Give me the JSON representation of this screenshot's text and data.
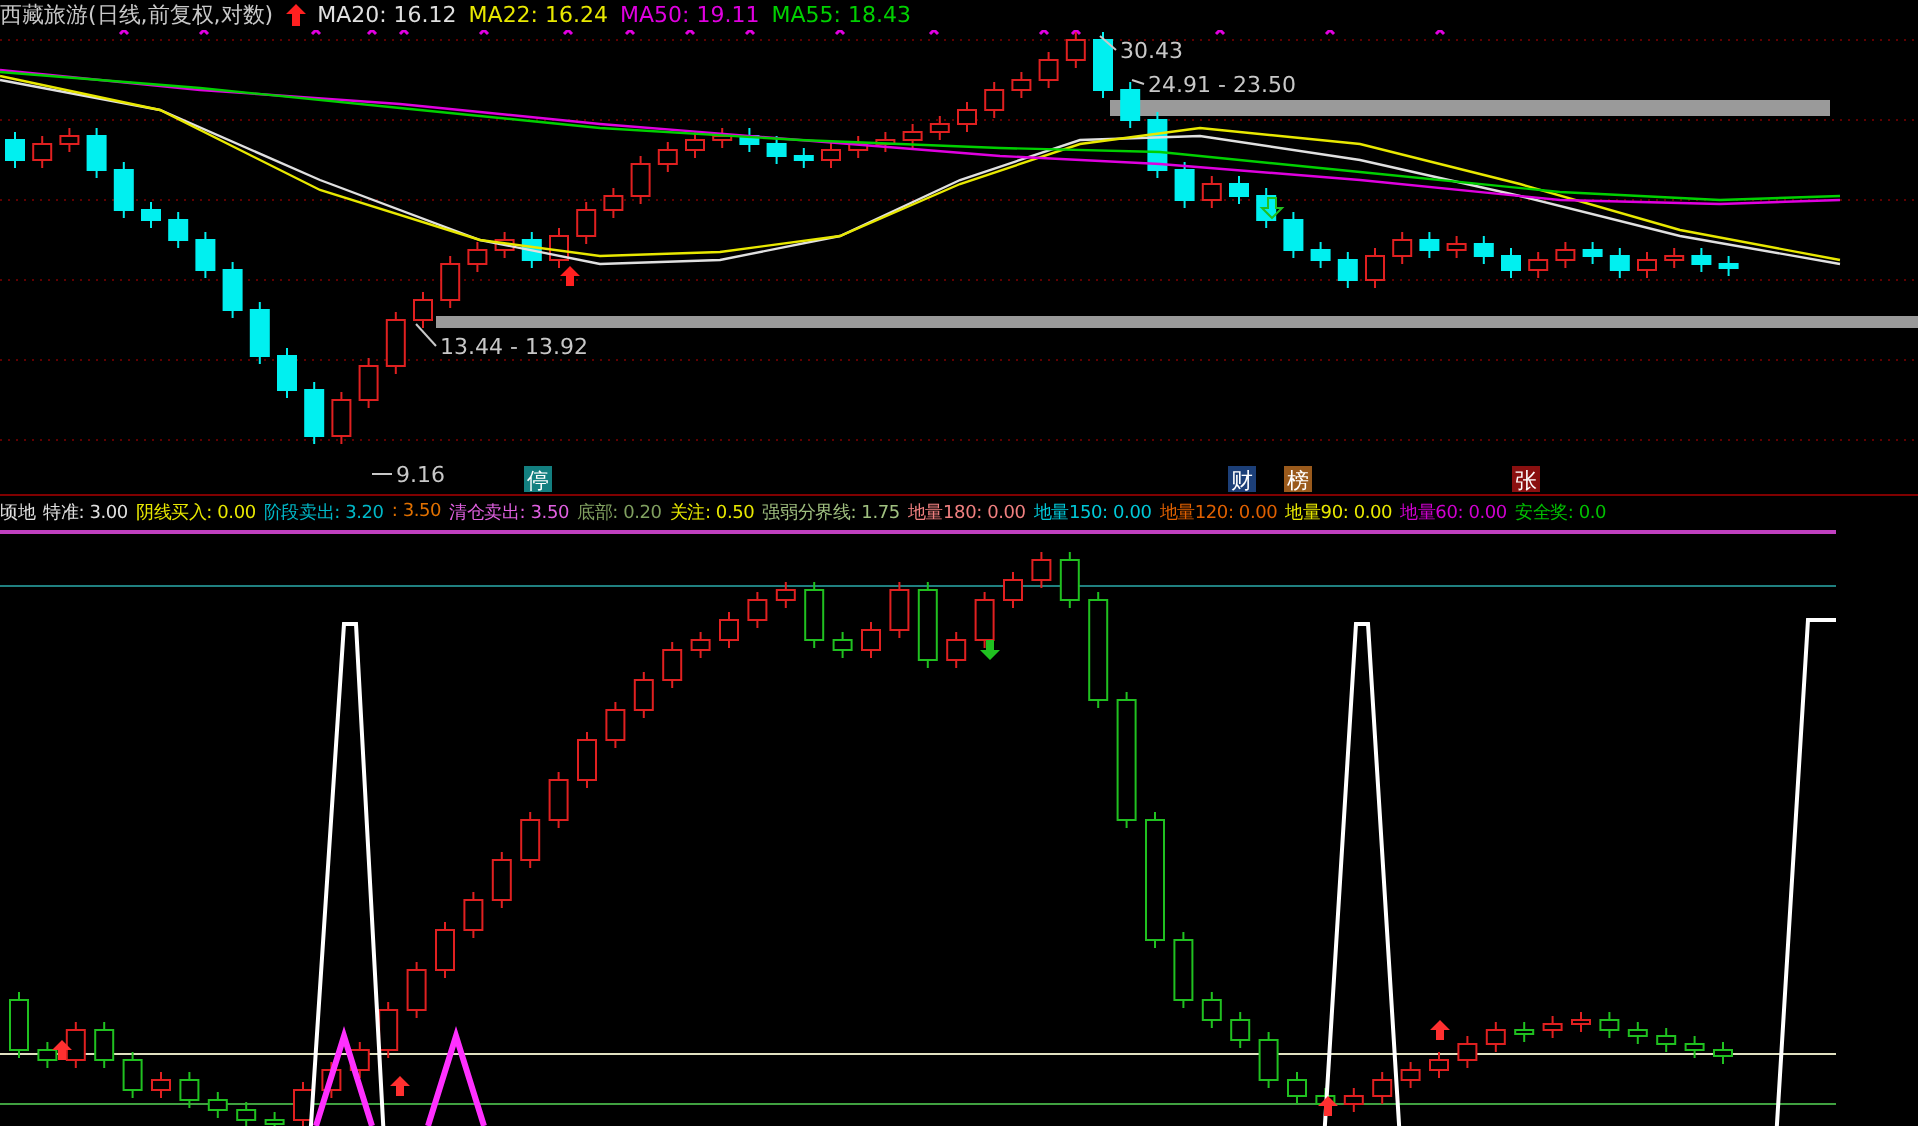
{
  "header": {
    "title": "西藏旅游(日线,前复权,对数)",
    "legend": [
      {
        "label": "MA20: 16.12",
        "color": "#e0e0e0"
      },
      {
        "label": "MA22: 16.24",
        "color": "#e8e800"
      },
      {
        "label": "MA50: 19.11",
        "color": "#e000e0"
      },
      {
        "label": "MA55: 18.43",
        "color": "#00d000"
      }
    ]
  },
  "price_chart": {
    "annotations": [
      {
        "text": "30.43"
      },
      {
        "text": "24.91 - 23.50"
      },
      {
        "text": "13.44 - 13.92"
      },
      {
        "text": "9.16"
      }
    ],
    "badges": [
      {
        "text": "停",
        "color": "#137f80"
      },
      {
        "text": "财",
        "color": "#1c3f78"
      },
      {
        "text": "榜",
        "color": "#9a5a1c"
      },
      {
        "text": "张",
        "color": "#8a1010"
      }
    ]
  },
  "indicator": {
    "legend": [
      {
        "label": "顷地",
        "color": "#e0e0e0"
      },
      {
        "label": "特准: 3.00",
        "color": "#e0e0e0"
      },
      {
        "label": "阴线买入: 0.00",
        "color": "#e8e800"
      },
      {
        "label": "阶段卖出: 3.20",
        "color": "#00b8c8"
      },
      {
        "label": ": 3.50",
        "color": "#e07000"
      },
      {
        "label": "清仓卖出: 3.50",
        "color": "#e060e0"
      },
      {
        "label": "底部: 0.20",
        "color": "#80a060"
      },
      {
        "label": "关注: 0.50",
        "color": "#e8e800"
      },
      {
        "label": "强弱分界线: 1.75",
        "color": "#a0c080"
      },
      {
        "label": "地量180: 0.00",
        "color": "#f08080"
      },
      {
        "label": "地量150: 0.00",
        "color": "#00c8d8"
      },
      {
        "label": "地量120: 0.00",
        "color": "#e06000"
      },
      {
        "label": "地量90: 0.00",
        "color": "#e8e800"
      },
      {
        "label": "地量60: 0.00",
        "color": "#d000d0"
      },
      {
        "label": "安全奖: 0.0",
        "color": "#00c000"
      }
    ]
  }
}
